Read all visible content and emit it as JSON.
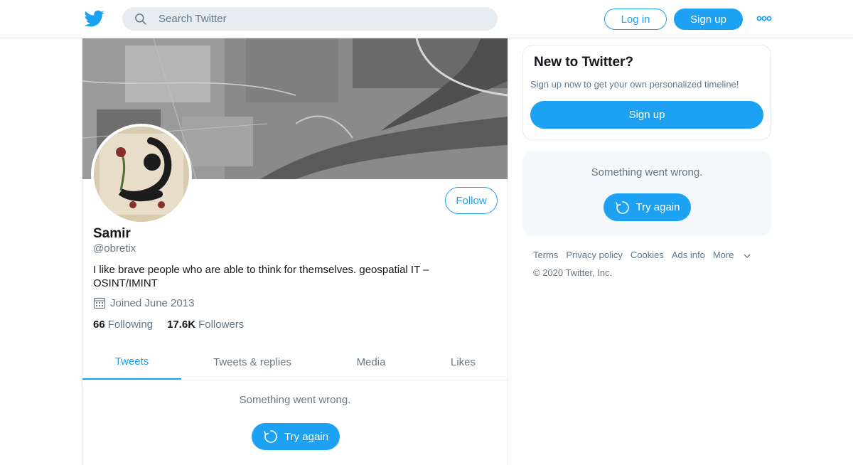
{
  "topbar": {
    "search_placeholder": "Search Twitter",
    "login_label": "Log in",
    "signup_label": "Sign up",
    "more_icon": "more-dots-icon"
  },
  "profile": {
    "name": "Samir",
    "handle": "@obretix",
    "bio": "I like brave people who are able to think for themselves. geospatial IT – OSINT/IMINT",
    "joined": "Joined June 2013",
    "following_count": "66",
    "following_label": "Following",
    "followers_count": "17.6K",
    "followers_label": "Followers",
    "follow_label": "Follow"
  },
  "tabs": [
    {
      "label": "Tweets",
      "active": true
    },
    {
      "label": "Tweets & replies",
      "active": false
    },
    {
      "label": "Media",
      "active": false
    },
    {
      "label": "Likes",
      "active": false
    }
  ],
  "timeline": {
    "error_text": "Something went wrong.",
    "retry_label": "Try again"
  },
  "sidebar": {
    "new_title": "New to Twitter?",
    "new_text": "Sign up now to get your own personalized timeline!",
    "signup_label": "Sign up",
    "error_text": "Something went wrong.",
    "retry_label": "Try again",
    "footer_links": [
      "Terms",
      "Privacy policy",
      "Cookies",
      "Ads info",
      "More"
    ],
    "copyright": "© 2020 Twitter, Inc."
  },
  "colors": {
    "accent": "#1da1f2",
    "secondary_text": "#657786",
    "border": "#e6ecf0"
  }
}
